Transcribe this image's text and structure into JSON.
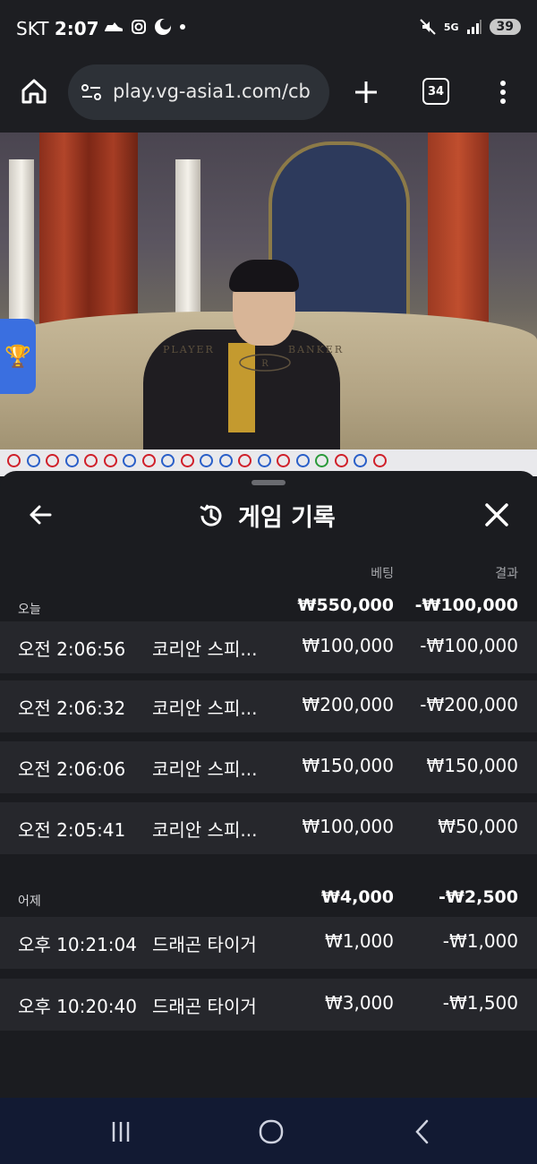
{
  "status_bar": {
    "carrier": "SKT",
    "time": "2:07",
    "battery": "39",
    "network": "5G"
  },
  "browser": {
    "url": "play.vg-asia1.com/cb",
    "tab_count": "34"
  },
  "video": {
    "table_labels": [
      "PLAYER",
      "BANKER"
    ]
  },
  "history": {
    "title": "게임 기록",
    "columns": {
      "bet": "베팅",
      "result": "결과"
    },
    "groups": [
      {
        "label": "오늘",
        "total_bet": "₩550,000",
        "total_result": "-₩100,000",
        "rows": [
          {
            "time": "오전 2:06:56",
            "game": "코리안 스피...",
            "bet": "₩100,000",
            "result": "-₩100,000"
          },
          {
            "time": "오전 2:06:32",
            "game": "코리안 스피...",
            "bet": "₩200,000",
            "result": "-₩200,000"
          },
          {
            "time": "오전 2:06:06",
            "game": "코리안 스피...",
            "bet": "₩150,000",
            "result": "₩150,000"
          },
          {
            "time": "오전 2:05:41",
            "game": "코리안 스피...",
            "bet": "₩100,000",
            "result": "₩50,000"
          }
        ]
      },
      {
        "label": "어제",
        "total_bet": "₩4,000",
        "total_result": "-₩2,500",
        "rows": [
          {
            "time": "오후 10:21:04",
            "game": "드래곤 타이거",
            "bet": "₩1,000",
            "result": "-₩1,000"
          },
          {
            "time": "오후 10:20:40",
            "game": "드래곤 타이거",
            "bet": "₩3,000",
            "result": "-₩1,500"
          }
        ]
      }
    ]
  },
  "icons": {
    "home": "home-icon",
    "site_info": "site-info-icon",
    "new_tab": "plus-icon",
    "menu": "more-vert-icon",
    "history": "history-icon",
    "back": "arrow-back-icon",
    "close": "close-icon",
    "trophy": "trophy-icon"
  },
  "colors": {
    "panel": "#1b1c20",
    "row": "#26272c",
    "accent_blue": "#3a6fe0",
    "nav": "#121a33"
  }
}
